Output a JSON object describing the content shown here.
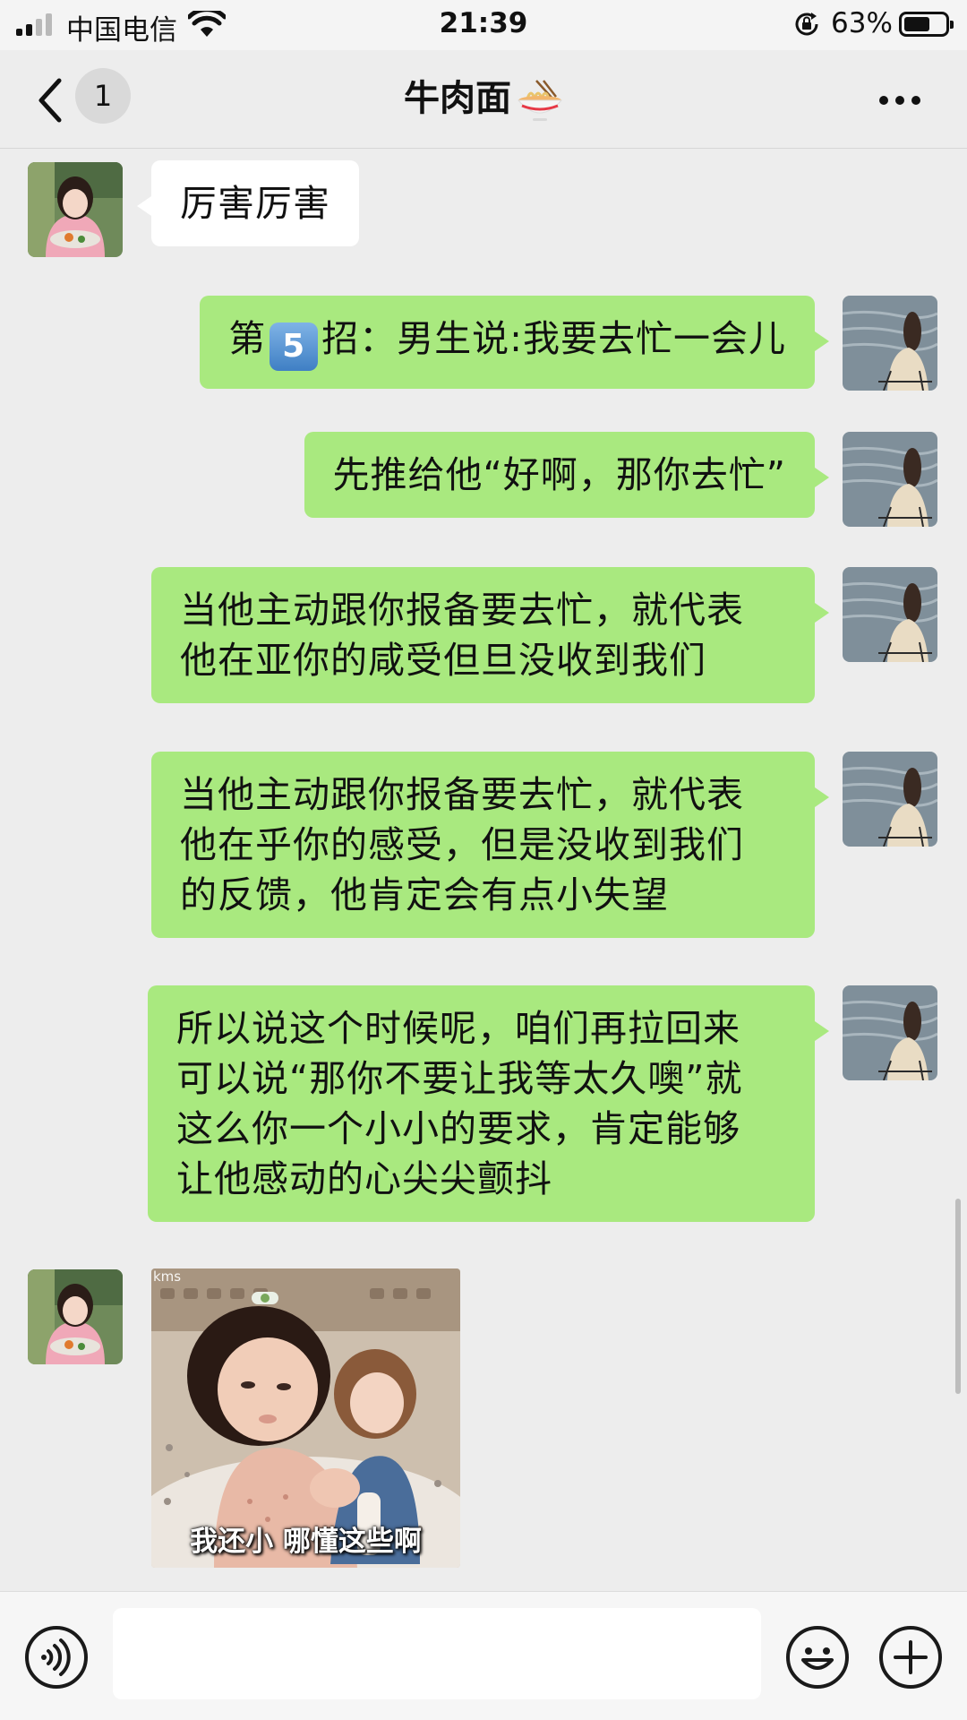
{
  "status_bar": {
    "carrier": "中国电信",
    "time": "21:39",
    "battery_percent_text": "63%",
    "battery_level": 0.63
  },
  "header": {
    "back_icon": "chevron-left-icon",
    "unread_count": "1",
    "title": "牛肉面",
    "title_emoji": "noodle-bowl-icon",
    "more_icon": "more-dots-icon"
  },
  "messages": [
    {
      "direction": "in",
      "type": "text",
      "text": "厉害厉害"
    },
    {
      "direction": "out",
      "type": "text",
      "prefix": "第",
      "emoji_number": "5",
      "text": "招：男生说:我要去忙一会儿"
    },
    {
      "direction": "out",
      "type": "text",
      "text": "先推给他“好啊，那你去忙”"
    },
    {
      "direction": "out",
      "type": "text",
      "lines": [
        "当他主动跟你报备要去忙，就代表",
        "他在亚你的咸受但旦没收到我们"
      ]
    },
    {
      "direction": "out",
      "type": "text",
      "lines": [
        "当他主动跟你报备要去忙，就代表",
        "他在乎你的感受，但是没收到我们",
        "的反馈，他肯定会有点小失望"
      ]
    },
    {
      "direction": "out",
      "type": "text",
      "lines": [
        "所以说这个时候呢，咱们再拉回来",
        "可以说“那你不要让我等太久噢”就",
        "这么你一个小小的要求，肯定能够",
        "让他感动的心尖尖颤抖"
      ]
    },
    {
      "direction": "in",
      "type": "sticker",
      "caption": "我还小  哪懂这些啊",
      "watermark": "kms"
    }
  ],
  "input_bar": {
    "voice_icon": "voice-icon",
    "text_value": "",
    "emoji_icon": "emoji-icon",
    "plus_icon": "plus-icon"
  },
  "colors": {
    "background": "#ededed",
    "outgoing_bubble": "#a9e97f",
    "incoming_bubble": "#ffffff"
  }
}
